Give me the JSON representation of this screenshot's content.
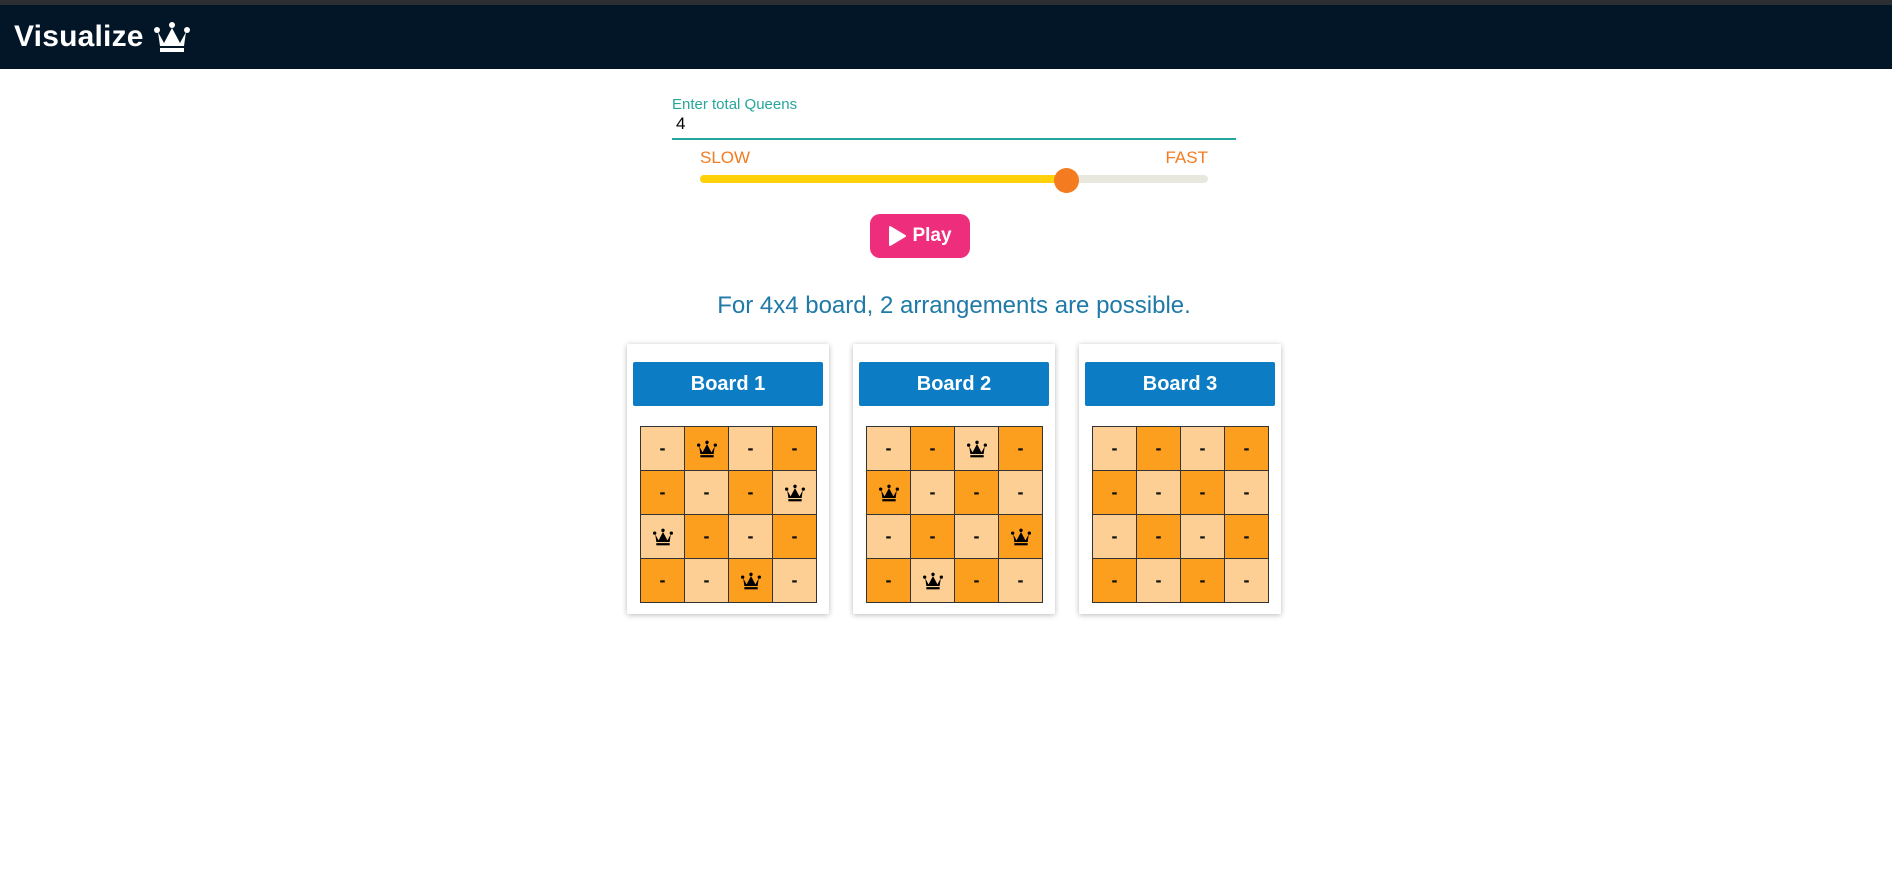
{
  "header": {
    "title": "Visualize",
    "icon": "crown-icon"
  },
  "controls": {
    "input_label": "Enter total Queens",
    "queens_value": "4",
    "speed_slow_label": "SLOW",
    "speed_fast_label": "FAST",
    "speed_fraction": 0.72,
    "play_label": "Play",
    "play_icon": "play-icon"
  },
  "result": {
    "text": "For 4x4 board, 2 arrangements are possible."
  },
  "boards": [
    {
      "title": "Board 1",
      "rows": [
        [
          "-",
          "Q",
          "-",
          "-"
        ],
        [
          "-",
          "-",
          "-",
          "Q"
        ],
        [
          "Q",
          "-",
          "-",
          "-"
        ],
        [
          "-",
          "-",
          "Q",
          "-"
        ]
      ]
    },
    {
      "title": "Board 2",
      "rows": [
        [
          "-",
          "-",
          "Q",
          "-"
        ],
        [
          "Q",
          "-",
          "-",
          "-"
        ],
        [
          "-",
          "-",
          "-",
          "Q"
        ],
        [
          "-",
          "Q",
          "-",
          "-"
        ]
      ]
    },
    {
      "title": "Board 3",
      "rows": [
        [
          "-",
          "-",
          "-",
          "-"
        ],
        [
          "-",
          "-",
          "-",
          "-"
        ],
        [
          "-",
          "-",
          "-",
          "-"
        ],
        [
          "-",
          "-",
          "-",
          "-"
        ]
      ]
    }
  ],
  "colors": {
    "navbar": "#021628",
    "accent_teal": "#26a69a",
    "speed_label": "#f47b20",
    "slider_fill": "#ffd10a",
    "slider_thumb": "#f47b20",
    "play_button": "#ee2d7c",
    "result_text": "#1f7aa8",
    "board_header": "#0c7cc4",
    "cell_light": "#fdcf94",
    "cell_dark": "#fd9f1e"
  }
}
